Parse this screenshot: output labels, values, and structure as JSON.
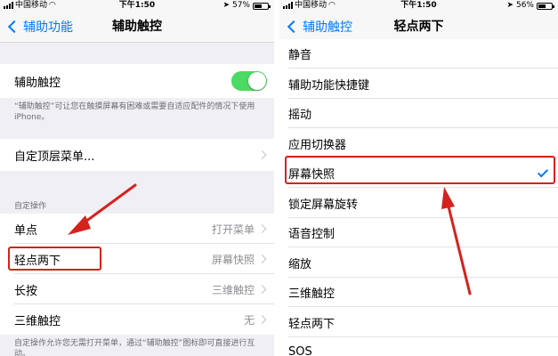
{
  "left": {
    "status": {
      "carrier": "中国移动",
      "time": "下午1:50",
      "battery_text": "57%",
      "battery_level": 0.57
    },
    "nav": {
      "back_label": "辅助功能",
      "title": "辅助触控"
    },
    "toggle_row": {
      "label": "辅助触控",
      "enabled": true
    },
    "toggle_note": "“辅助触控”可让您在触摸屏幕有困难或需要自适应配件的情况下使用 iPhone。",
    "top_menu_row": {
      "label": "自定顶层菜单..."
    },
    "section_header": "自定操作",
    "actions": [
      {
        "label": "单点",
        "value": "打开菜单"
      },
      {
        "label": "轻点两下",
        "value": "屏幕快照"
      },
      {
        "label": "长按",
        "value": "三维触控"
      },
      {
        "label": "三维触控",
        "value": "无"
      }
    ],
    "actions_note": "自定操作允许您无需打开菜单，通过“辅助触控”图标即可直接进行互动。"
  },
  "right": {
    "status": {
      "carrier": "中国移动",
      "time": "下午1:50",
      "battery_text": "56%",
      "battery_level": 0.56
    },
    "nav": {
      "back_label": "辅助触控",
      "title": "轻点两下"
    },
    "options": [
      {
        "label": "静音",
        "selected": false
      },
      {
        "label": "辅助功能快捷键",
        "selected": false
      },
      {
        "label": "摇动",
        "selected": false
      },
      {
        "label": "应用切换器",
        "selected": false
      },
      {
        "label": "屏幕快照",
        "selected": true
      },
      {
        "label": "锁定屏幕旋转",
        "selected": false
      },
      {
        "label": "语音控制",
        "selected": false
      },
      {
        "label": "缩放",
        "selected": false
      },
      {
        "label": "三维触控",
        "selected": false
      },
      {
        "label": "轻点两下",
        "selected": false
      },
      {
        "label": "SOS",
        "selected": false
      }
    ]
  },
  "colors": {
    "accent": "#007aff",
    "toggle_on": "#4cd964",
    "annotation": "#d6221d"
  }
}
